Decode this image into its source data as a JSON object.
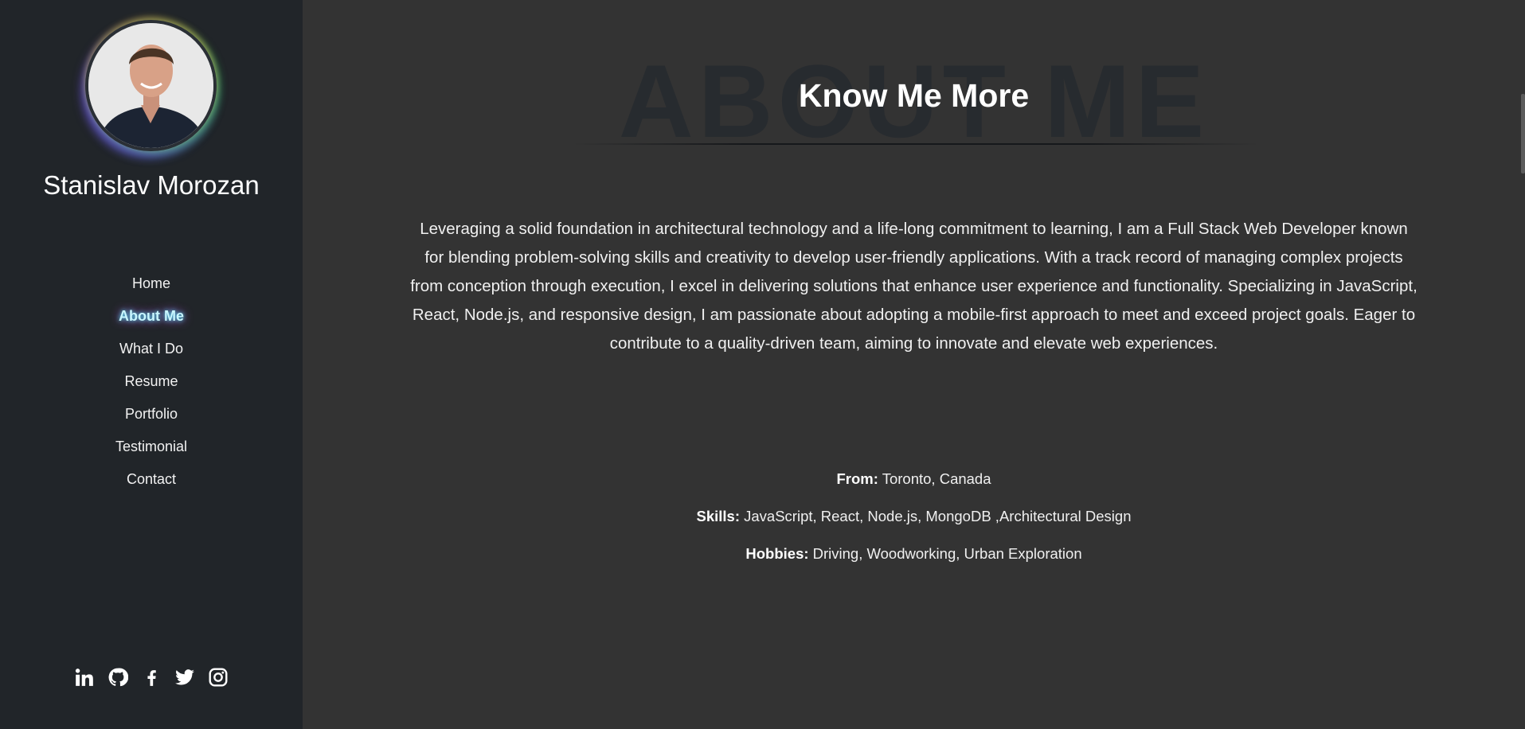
{
  "sidebar": {
    "owner_name": "Stanislav Morozan",
    "nav": [
      {
        "label": "Home",
        "active": false
      },
      {
        "label": "About Me",
        "active": true
      },
      {
        "label": "What I Do",
        "active": false
      },
      {
        "label": "Resume",
        "active": false
      },
      {
        "label": "Portfolio",
        "active": false
      },
      {
        "label": "Testimonial",
        "active": false
      },
      {
        "label": "Contact",
        "active": false
      }
    ],
    "social_icons": [
      "linkedin-icon",
      "github-icon",
      "facebook-icon",
      "twitter-icon",
      "instagram-icon"
    ]
  },
  "section": {
    "background_title": "ABOUT ME",
    "title": "Know Me More",
    "bio": "Leveraging a solid foundation in architectural technology and a life-long commitment to learning, I am a Full Stack Web Developer known for blending problem-solving skills and creativity to develop user-friendly applications. With a track record of managing complex projects from conception through execution, I excel in delivering solutions that enhance user experience and functionality. Specializing in JavaScript, React, Node.js, and responsive design, I am passionate about adopting a mobile-first approach to meet and exceed project goals. Eager to contribute to a quality-driven team, aiming to innovate and elevate web experiences.",
    "facts": [
      {
        "label": "From:",
        "value": "Toronto, Canada"
      },
      {
        "label": "Skills:",
        "value": "JavaScript, React, Node.js, MongoDB ,Architectural Design"
      },
      {
        "label": "Hobbies:",
        "value": "Driving, Woodworking, Urban Exploration"
      }
    ]
  },
  "colors": {
    "sidebar_bg": "#212529",
    "main_bg": "#333333",
    "active_glow": "#4ff0ff"
  }
}
